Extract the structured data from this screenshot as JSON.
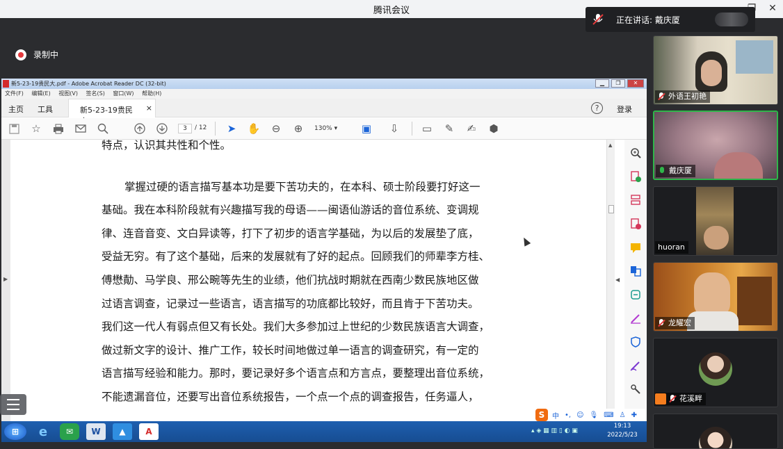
{
  "app": {
    "title": "腾讯会议",
    "recording_label": "录制中",
    "speaking_label": "正在讲话: 戴庆厦"
  },
  "acrobat": {
    "window_title": "新5-23-19贵民大.pdf - Adobe Acrobat Reader DC (32-bit)",
    "menu": [
      "文件(F)",
      "编辑(E)",
      "视图(V)",
      "签名(S)",
      "窗口(W)",
      "帮助(H)"
    ],
    "tabs": {
      "home": "主页",
      "tools": "工具",
      "document": "新5-23-19贵民大.pdf",
      "close": "×"
    },
    "help": "?",
    "login": "登录",
    "page_current": "3",
    "page_total": "/ 12",
    "zoom": "130%",
    "lines": [
      "特点，认识其共性和个性。",
      "掌握过硬的语言描写基本功是要下苦功夫的，在本科、硕士阶段要打好这一",
      "基础。我在本科阶段就有兴趣描写我的母语——闽语仙游话的音位系统、变调规",
      "律、连音音变、文白异读等，打下了初步的语言学基础，为以后的发展垫了底，",
      "受益无穷。有了这个基础，后来的发展就有了好的起点。回顾我们的师辈李方桂、",
      "傅懋勣、马学良、邢公畹等先生的业绩，他们抗战时期就在西南少数民族地区做",
      "过语言调查，记录过一些语言，语言描写的功底都比较好，而且肯于下苦功夫。",
      "我们这一代人有弱点但又有长处。我们大多参加过上世纪的少数民族语言大调查，",
      "做过新文字的设计、推广工作，较长时间地做过单一语言的调查研究，有一定的",
      "语言描写经验和能力。那时，要记录好多个语言点和方言点，要整理出音位系统，",
      "不能遗漏音位，还要写出音位系统报告，一个点一个点的调查报告，任务逼人，"
    ]
  },
  "taskbar": {
    "clock_time": "19:13",
    "clock_date": "2022/5/23",
    "ime_label": "中"
  },
  "participants": [
    {
      "name": "外语王初艳",
      "mic": "muted"
    },
    {
      "name": "戴庆厦",
      "mic": "active"
    },
    {
      "name": "huoran",
      "mic": "none"
    },
    {
      "name": "龙耀宏",
      "mic": "muted"
    },
    {
      "name": "花溪畔",
      "mic": "muted"
    },
    {
      "name": "",
      "mic": "none"
    }
  ],
  "colors": {
    "accent_green": "#2fb64a",
    "muted_red": "#e23b3b",
    "acrobat_red": "#d42b2b"
  }
}
